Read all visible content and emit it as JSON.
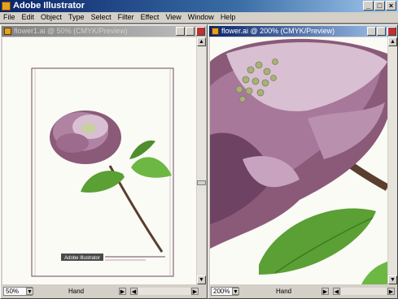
{
  "app": {
    "title": "Adobe Illustrator"
  },
  "menu": [
    "File",
    "Edit",
    "Object",
    "Type",
    "Select",
    "Filter",
    "Effect",
    "View",
    "Window",
    "Help"
  ],
  "doc_left": {
    "title": "flower1.ai @ 50% (CMYK/Preview)",
    "zoom": "50%",
    "tool": "Hand",
    "caption": "Adobe Illustrator"
  },
  "doc_right": {
    "title": "flower.ai @ 200% (CMYK/Preview)",
    "zoom": "200%",
    "tool": "Hand"
  },
  "colors": {
    "petal_dark": "#8a5a78",
    "petal_light": "#d8bfd2",
    "leaf": "#5aa034",
    "stem": "#5a3e2e",
    "title_active": "#0a246a"
  }
}
